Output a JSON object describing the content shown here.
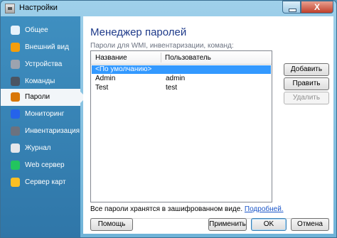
{
  "window": {
    "title": "Настройки",
    "close_label": "X"
  },
  "sidebar": {
    "items": [
      {
        "label": "Общее",
        "icon": "gear-icon",
        "color": "#e6f2fb"
      },
      {
        "label": "Внешний вид",
        "icon": "palette-icon",
        "color": "#f59e0b"
      },
      {
        "label": "Устройства",
        "icon": "printer-icon",
        "color": "#9ca3af"
      },
      {
        "label": "Команды",
        "icon": "terminal-icon",
        "color": "#4b5563"
      },
      {
        "label": "Пароли",
        "icon": "key-icon",
        "color": "#d97706"
      },
      {
        "label": "Мониторинг",
        "icon": "monitor-icon",
        "color": "#2563eb"
      },
      {
        "label": "Инвентаризация",
        "icon": "inventory-icon",
        "color": "#6b7280"
      },
      {
        "label": "Журнал",
        "icon": "log-icon",
        "color": "#e5e7eb"
      },
      {
        "label": "Web сервер",
        "icon": "globe-icon",
        "color": "#22c55e"
      },
      {
        "label": "Сервер карт",
        "icon": "map-icon",
        "color": "#fbbf24"
      }
    ]
  },
  "main": {
    "title": "Менеджер паролей",
    "subtitle": "Пароли для WMI, инвентаризации, команд:",
    "table": {
      "columns": [
        "Название",
        "Пользователь"
      ],
      "rows": [
        {
          "name": "<По умолчанию>",
          "user": "",
          "selected": true
        },
        {
          "name": "Admin",
          "user": "admin",
          "selected": false
        },
        {
          "name": "Test",
          "user": "test",
          "selected": false
        }
      ]
    },
    "note": "Все пароли хранятся в зашифрованном виде.",
    "note_link": "Подробней.",
    "buttons": {
      "add": "Добавить",
      "edit": "Править",
      "delete": "Удалить",
      "help": "Помощь",
      "apply": "Применить",
      "ok": "OK",
      "cancel": "Отмена"
    }
  }
}
